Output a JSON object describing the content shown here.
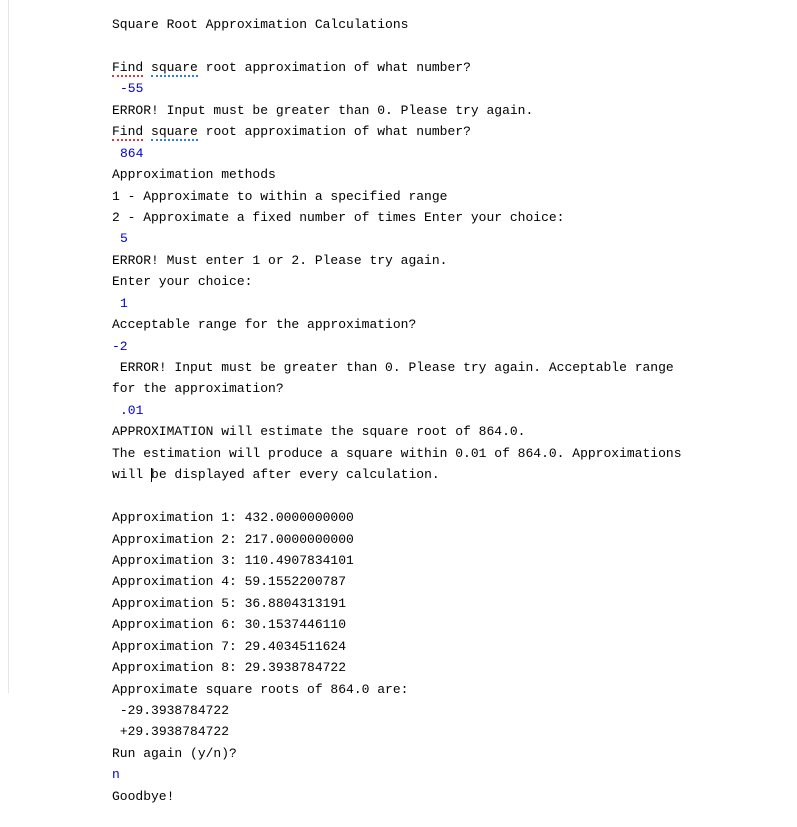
{
  "title": "Square Root Approximation Calculations",
  "prompt_find_a": "Find",
  "prompt_find_b": "square",
  "prompt_find_rest": " root approximation of what number?",
  "input_neg55": "-55",
  "err_gt0": "ERROR! Input must be greater than 0. Please try again.",
  "input_864": "864",
  "methods_header": "Approximation methods",
  "method1": "1 - Approximate to within a specified range",
  "method2": "2 - Approximate a fixed number of times Enter your choice:",
  "input_5": "5",
  "err_1or2": "ERROR! Must enter 1 or 2. Please try again.",
  "enter_choice": "Enter your choice:",
  "input_1": "1",
  "range_prompt": "Acceptable range for the approximation?",
  "input_neg2": "-2",
  "err_gt0_range": " ERROR! Input must be greater than 0. Please try again. Acceptable range for the approximation?",
  "input_p01": ".01",
  "approx_intro": "APPROXIMATION will estimate the square root of 864.0.",
  "approx_detail_a": "The estimation will produce a square within 0.01 of 864.0. Approximations will ",
  "approx_detail_b": "e displayed after every calculation.",
  "a1": "Approximation 1: 432.0000000000",
  "a2": "Approximation 2: 217.0000000000",
  "a3": "Approximation 3: 110.4907834101",
  "a4": "Approximation 4: 59.1552200787",
  "a5": "Approximation 5: 36.8804313191",
  "a6": "Approximation 6: 30.1537446110",
  "a7": "Approximation 7: 29.4034511624",
  "a8": "Approximation 8: 29.3938784722",
  "result_hdr": "Approximate square roots of 864.0 are:",
  "neg_root": " -29.3938784722",
  "pos_root": " +29.3938784722",
  "run_again": "Run again (y/n)?",
  "input_n": "n",
  "goodbye": "Goodbye!"
}
